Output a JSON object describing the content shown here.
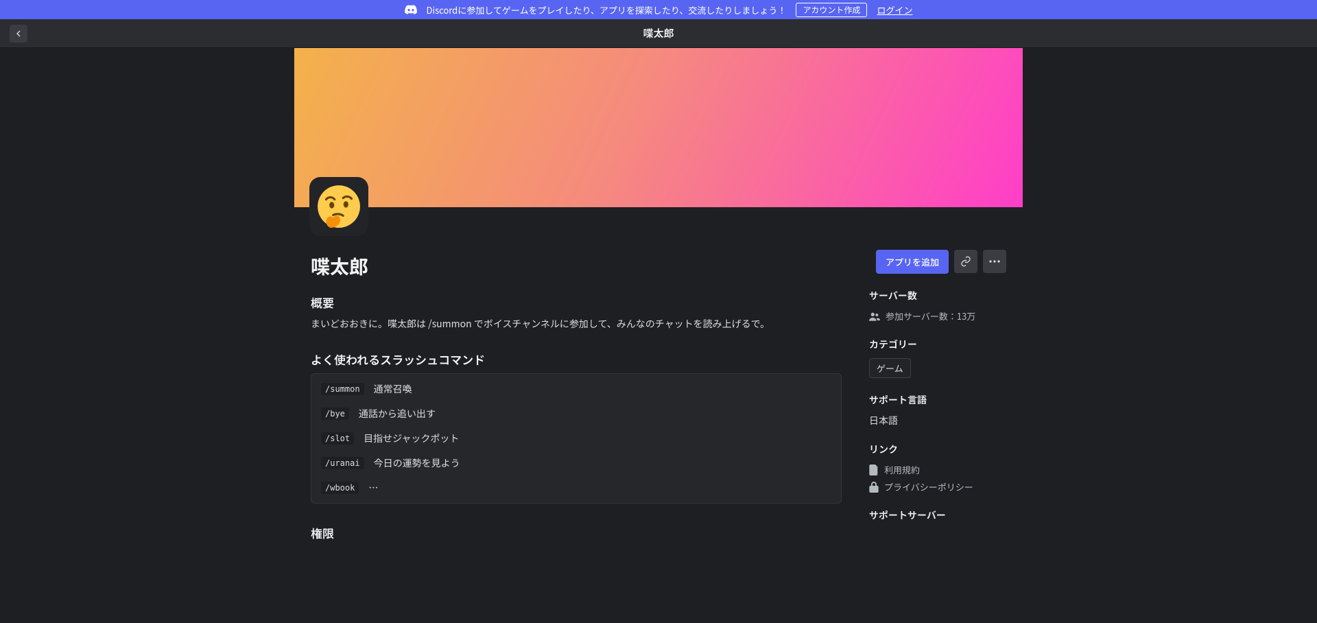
{
  "promo": {
    "text": "Discordに参加してゲームをプレイしたり、アプリを探索したり、交流したりしましょう！",
    "create_account": "アカウント作成",
    "login": "ログイン"
  },
  "header": {
    "title": "喋太郎"
  },
  "app": {
    "name": "喋太郎",
    "overview_head": "概要",
    "overview_body": "まいどおおきに。喋太郎は /summon でボイスチャンネルに参加して、みんなのチャットを読み上げるで。",
    "slash_head": "よく使われるスラッシュコマンド",
    "slash": [
      {
        "cmd": "/summon",
        "desc": "通常召喚"
      },
      {
        "cmd": "/bye",
        "desc": "通話から追い出す"
      },
      {
        "cmd": "/slot",
        "desc": "目指せジャックポット"
      },
      {
        "cmd": "/uranai",
        "desc": "今日の運勢を見よう"
      },
      {
        "cmd": "/wbook",
        "desc": "…"
      }
    ],
    "perm_head": "権限"
  },
  "actions": {
    "add": "アプリを追加"
  },
  "side": {
    "servers_head": "サーバー数",
    "servers_value": "参加サーバー数：13万",
    "category_head": "カテゴリー",
    "category_chip": "ゲーム",
    "lang_head": "サポート言語",
    "lang_value": "日本語",
    "links_head": "リンク",
    "link_terms": "利用規約",
    "link_privacy": "プライバシーポリシー",
    "support_head": "サポートサーバー"
  }
}
